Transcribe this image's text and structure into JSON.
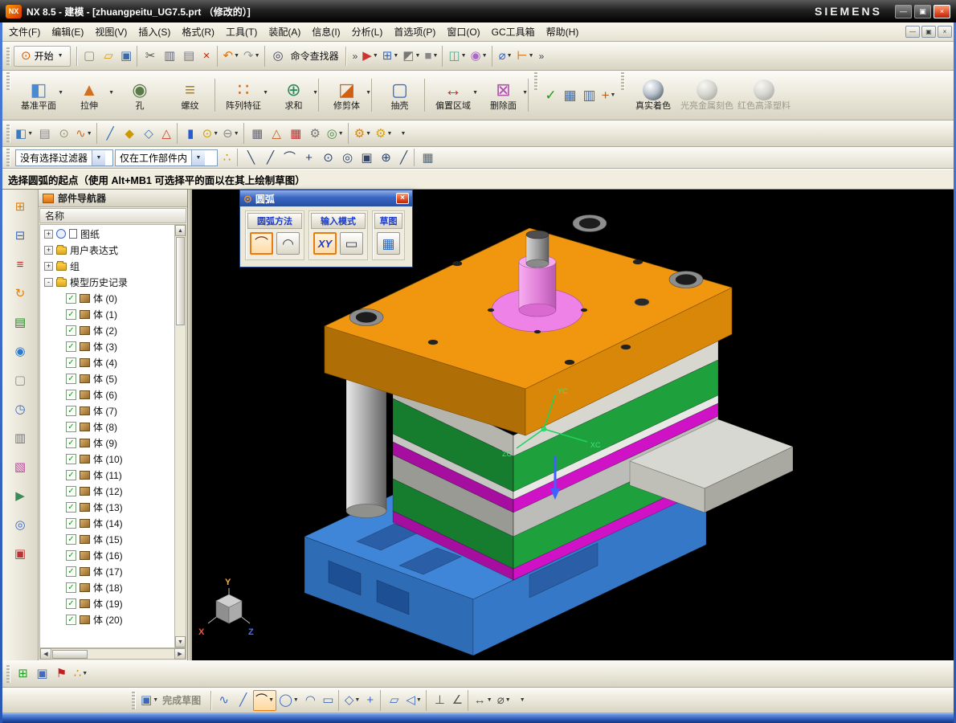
{
  "window": {
    "logo": "NX",
    "title": "NX 8.5 - 建模 - [zhuangpeitu_UG7.5.prt （修改的）]",
    "brand": "SIEMENS"
  },
  "menu": {
    "items": [
      "文件(F)",
      "编辑(E)",
      "视图(V)",
      "插入(S)",
      "格式(R)",
      "工具(T)",
      "装配(A)",
      "信息(I)",
      "分析(L)",
      "首选项(P)",
      "窗口(O)",
      "GC工具箱",
      "帮助(H)"
    ]
  },
  "toolbar_top": {
    "start_label": "开始",
    "finder_label": "命令查找器"
  },
  "toolbars": {
    "row1": [
      {
        "name": "new-file-icon",
        "g": "▢",
        "c": "#8a8a7a"
      },
      {
        "name": "open-folder-icon",
        "g": "▱",
        "c": "#d49a1a"
      },
      {
        "name": "save-icon",
        "g": "▣",
        "c": "#3a6aaa",
        "sep": true
      },
      {
        "name": "cut-icon",
        "g": "✂",
        "c": "#555"
      },
      {
        "name": "copy-icon",
        "g": "▥",
        "c": "#667"
      },
      {
        "name": "paste-icon",
        "g": "▤",
        "c": "#778"
      },
      {
        "name": "delete-icon",
        "g": "×",
        "c": "#cc2200",
        "sep": true
      },
      {
        "name": "undo-icon",
        "g": "↶",
        "c": "#e07000",
        "dd": true
      },
      {
        "name": "redo-icon",
        "g": "↷",
        "c": "#999",
        "dd": true,
        "sep": true
      },
      {
        "name": "command-finder-icon",
        "g": "◎",
        "c": "#446"
      }
    ],
    "row1b": [
      {
        "name": "selection-arrow-icon",
        "g": "▶",
        "c": "#c33",
        "dd": true
      },
      {
        "name": "window-layout-icon",
        "g": "⊞",
        "c": "#36c",
        "dd": true
      },
      {
        "name": "display-mode-icon",
        "g": "◩",
        "c": "#777",
        "dd": true
      },
      {
        "name": "background-color-icon",
        "g": "■",
        "c": "#888",
        "dd": true,
        "sep": true
      },
      {
        "name": "snapshot-icon",
        "g": "◫",
        "c": "#4a8",
        "dd": true
      },
      {
        "name": "visual-effects-icon",
        "g": "◉",
        "c": "#a6c",
        "dd": true,
        "sep": true
      },
      {
        "name": "measure-distance-icon",
        "g": "⌀",
        "c": "#36c",
        "dd": true
      },
      {
        "name": "ruler-icon",
        "g": "⊢",
        "c": "#c60",
        "dd": true
      }
    ],
    "row3": [
      {
        "name": "datum-plane-small-icon",
        "g": "◧",
        "c": "#3a7ac0",
        "dd": true
      },
      {
        "name": "layers-icon",
        "g": "▤",
        "c": "#888"
      },
      {
        "name": "revolve-icon",
        "g": "⊙",
        "c": "#997"
      },
      {
        "name": "spring-icon",
        "g": "∿",
        "c": "#c07030",
        "dd": true,
        "sep": true
      },
      {
        "name": "sketch-curve-icon",
        "g": "╱",
        "c": "#2a6ac0"
      },
      {
        "name": "edit-feature-icon",
        "g": "◆",
        "c": "#cc9900"
      },
      {
        "name": "datum-axis-icon",
        "g": "◇",
        "c": "#3a7ac0"
      },
      {
        "name": "chamfer-icon",
        "g": "△",
        "c": "#cc4422",
        "sep": true
      },
      {
        "name": "cylinder-icon",
        "g": "▮",
        "c": "#2a5ad0"
      },
      {
        "name": "torus-icon",
        "g": "⊙",
        "c": "#d0a010",
        "dd": true
      },
      {
        "name": "boolean-subtract-icon",
        "g": "⊖",
        "c": "#888",
        "dd": true,
        "sep": true
      },
      {
        "name": "expression-table-icon",
        "g": "▦",
        "c": "#667"
      },
      {
        "name": "triangle-analysis-icon",
        "g": "△",
        "c": "#c06020"
      },
      {
        "name": "spreadsheet-icon",
        "g": "▦",
        "c": "#c03030"
      },
      {
        "name": "gears-icon",
        "g": "⚙",
        "c": "#777"
      },
      {
        "name": "target-point-icon",
        "g": "◎",
        "c": "#4a8a4a",
        "dd": true,
        "sep": true
      },
      {
        "name": "gc-gear-icon",
        "g": "⚙",
        "c": "#e08000",
        "dd": true
      },
      {
        "name": "gc-tools-icon",
        "g": "⚙",
        "c": "#e0a000",
        "dd": true
      }
    ],
    "selection_icons": [
      {
        "name": "snap-point-menu-icon",
        "g": "∴",
        "c": "#c80",
        "sep": true
      },
      {
        "name": "endpoint-snap-icon",
        "g": "╲",
        "c": "#346"
      },
      {
        "name": "midpoint-snap-icon",
        "g": "╱",
        "c": "#346"
      },
      {
        "name": "arc-snap-icon",
        "g": "⌒",
        "c": "#346"
      },
      {
        "name": "point-snap-icon",
        "g": "+",
        "c": "#346"
      },
      {
        "name": "center-snap-icon",
        "g": "⊙",
        "c": "#346"
      },
      {
        "name": "quadrant-snap-icon",
        "g": "◎",
        "c": "#346"
      },
      {
        "name": "intersection-snap-icon",
        "g": "▣",
        "c": "#346"
      },
      {
        "name": "existing-point-snap-icon",
        "g": "⊕",
        "c": "#346"
      },
      {
        "name": "tangent-snap-icon",
        "g": "╱",
        "c": "#346",
        "sep": true
      },
      {
        "name": "grid-snap-icon",
        "g": "▦",
        "c": "#567"
      }
    ]
  },
  "feature_toolbar": {
    "buttons": [
      {
        "label": "基准平面",
        "g": "◧",
        "c": "#4a8ad0",
        "dd": true,
        "name": "datum-plane-button"
      },
      {
        "label": "拉伸",
        "g": "▲",
        "c": "#d07020",
        "dd": true,
        "name": "extrude-button"
      },
      {
        "label": "孔",
        "g": "◉",
        "c": "#5a7a4a",
        "name": "hole-button"
      },
      {
        "label": "螺纹",
        "g": "≡",
        "c": "#b08020",
        "sep": true,
        "name": "thread-button"
      },
      {
        "label": "阵列特征",
        "g": "∷",
        "c": "#d06010",
        "dd": true,
        "name": "pattern-feature-button"
      },
      {
        "label": "求和",
        "g": "⊕",
        "c": "#2a8a5a",
        "dd": true,
        "sep": true,
        "name": "unite-button"
      },
      {
        "label": "修剪体",
        "g": "◪",
        "c": "#d06010",
        "dd": true,
        "sep": true,
        "name": "trim-body-button"
      },
      {
        "label": "抽壳",
        "g": "▢",
        "c": "#2a6ac0",
        "sep": true,
        "name": "shell-button"
      },
      {
        "label": "偏置区域",
        "g": "↔",
        "c": "#c03030",
        "dd": true,
        "name": "offset-region-button"
      },
      {
        "label": "删除面",
        "g": "⊠",
        "c": "#b050b0",
        "dd": true,
        "sep": true,
        "name": "delete-face-button"
      }
    ],
    "utility": [
      {
        "name": "ok-check-icon",
        "g": "✓",
        "c": "#1a9a1a"
      },
      {
        "name": "view-table-icon",
        "g": "▦",
        "c": "#446aa0"
      },
      {
        "name": "edit-table-icon",
        "g": "▥",
        "c": "#446aa0"
      },
      {
        "name": "csys-icon",
        "g": "+",
        "c": "#c06010",
        "dd": true
      }
    ],
    "render_buttons": [
      {
        "label": "真实着色",
        "name": "true-shading-button"
      },
      {
        "label": "光亮金属刻色",
        "disabled": true,
        "name": "shiny-metal-button"
      },
      {
        "label": "红色高泽塑料",
        "disabled": true,
        "name": "red-plastic-button"
      }
    ]
  },
  "selection": {
    "filter": "没有选择过滤器",
    "scope": "仅在工作部件内"
  },
  "prompt": {
    "text": "选择圆弧的起点（使用 Alt+MB1 可选择平的面以在其上绘制草图）"
  },
  "rail": {
    "items": [
      {
        "name": "assembly-navigator-icon",
        "g": "⊞",
        "c": "#e08000"
      },
      {
        "name": "constraint-navigator-icon",
        "g": "⊟",
        "c": "#3a6ac0"
      },
      {
        "name": "part-navigator-icon",
        "g": "≡",
        "c": "#c03030"
      },
      {
        "name": "reuse-library-icon",
        "g": "↻",
        "c": "#e08000"
      },
      {
        "name": "layers-rail-icon",
        "g": "▤",
        "c": "#1a8a1a"
      },
      {
        "name": "info-icon",
        "g": "◉",
        "c": "#2a7ad0"
      },
      {
        "name": "notes-icon",
        "g": "▢",
        "c": "#888"
      },
      {
        "name": "history-icon",
        "g": "◷",
        "c": "#3a6ac0"
      },
      {
        "name": "hd3d-tools-icon",
        "g": "▥",
        "c": "#777"
      },
      {
        "name": "palette-icon",
        "g": "▧",
        "c": "#c040a0"
      },
      {
        "name": "process-studio-icon",
        "g": "▶",
        "c": "#3a8a5a"
      },
      {
        "name": "roles-icon",
        "g": "◎",
        "c": "#3a6ac0"
      },
      {
        "name": "windows-rail-icon",
        "g": "▣",
        "c": "#c03030"
      }
    ]
  },
  "navigator": {
    "title": "部件导航器",
    "column": "名称",
    "items": [
      {
        "label": "图纸",
        "exp": "+"
      },
      {
        "label": "用户表达式",
        "exp": "+"
      },
      {
        "label": "组",
        "exp": "+"
      },
      {
        "label": "模型历史记录",
        "exp": "-"
      }
    ],
    "bodies": [
      "体 (0)",
      "体 (1)",
      "体 (2)",
      "体 (3)",
      "体 (4)",
      "体 (5)",
      "体 (6)",
      "体 (7)",
      "体 (8)",
      "体 (9)",
      "体 (10)",
      "体 (11)",
      "体 (12)",
      "体 (13)",
      "体 (14)",
      "体 (15)",
      "体 (16)",
      "体 (17)",
      "体 (18)",
      "体 (19)",
      "体 (20)"
    ]
  },
  "dialog": {
    "title": "圆弧",
    "xy": "XY",
    "groups": [
      {
        "label": "圆弧方法"
      },
      {
        "label": "输入模式"
      },
      {
        "label": "草图"
      }
    ]
  },
  "bottom": {
    "finish_label": "完成草图",
    "small_icons": [
      {
        "name": "new-window-icon",
        "g": "⊞",
        "c": "#2a9a2a"
      },
      {
        "name": "cascade-window-icon",
        "g": "▣",
        "c": "#446ac0"
      },
      {
        "name": "bookmark-icon",
        "g": "⚑",
        "c": "#c22020"
      },
      {
        "name": "tracking-icon",
        "g": "∴",
        "c": "#e08000",
        "dd": true
      }
    ],
    "sketch_icons": [
      {
        "name": "profile-icon",
        "g": "∿",
        "c": "#3a6ac0"
      },
      {
        "name": "line-icon",
        "g": "╱",
        "c": "#3a6ac0"
      },
      {
        "name": "arc-icon",
        "g": "⌒",
        "c": "#222",
        "active": true,
        "dd": true
      },
      {
        "name": "circle-icon",
        "g": "◯",
        "c": "#3a6ac0",
        "dd": true
      },
      {
        "name": "fillet-icon",
        "g": "◠",
        "c": "#3a6ac0"
      },
      {
        "name": "rectangle-icon",
        "g": "▭",
        "c": "#3a6ac0",
        "sep": true
      },
      {
        "name": "polygon-icon",
        "g": "◇",
        "c": "#3a6ac0",
        "dd": true
      },
      {
        "name": "point-icon",
        "g": "+",
        "c": "#3a6ac0",
        "sep": true
      },
      {
        "name": "offset-curve-icon",
        "g": "▱",
        "c": "#3a6ac0"
      },
      {
        "name": "mirror-curve-icon",
        "g": "◁",
        "c": "#3a6ac0",
        "dd": true,
        "sep": true
      },
      {
        "name": "perpendicular-constraint-icon",
        "g": "⊥",
        "c": "#555"
      },
      {
        "name": "angle-constraint-icon",
        "g": "∠",
        "c": "#555",
        "sep": true
      },
      {
        "name": "dimension-icon",
        "g": "↔",
        "c": "#555",
        "dd": true
      },
      {
        "name": "diameter-dimension-icon",
        "g": "⌀",
        "c": "#555",
        "dd": true
      }
    ]
  },
  "viewport": {
    "triad": {
      "x": "X",
      "y": "Y",
      "z": "Z"
    },
    "wcs": {
      "x": "XC",
      "y": "YC",
      "z": "ZC"
    }
  },
  "icons": {
    "dd": "▼",
    "min": "—",
    "restore": "▣",
    "close": "×",
    "chev": "»",
    "check": "✓",
    "up": "▲",
    "down": "▼",
    "left": "◀",
    "right": "▶",
    "start": "⊙",
    "finder": "◎",
    "dialog-gear": "⊙",
    "arc1": "⌒",
    "arc2": "◠",
    "ruler": "▭",
    "pencil": "╱",
    "finish": "▣",
    "sketch-mini": "▦"
  }
}
